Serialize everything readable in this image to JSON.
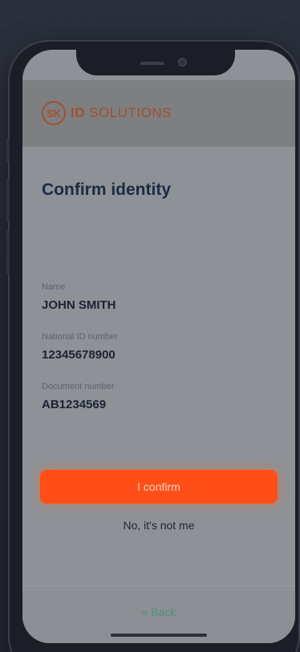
{
  "brand": {
    "logo_mark": "SK",
    "name_bold": "ID",
    "name_rest": " SOLUTIONS",
    "color": "#a2502f"
  },
  "screen": {
    "title": "Confirm identity"
  },
  "fields": [
    {
      "label": "Name",
      "value": "JOHN SMITH"
    },
    {
      "label": "National ID number",
      "value": "12345678900"
    },
    {
      "label": "Document number",
      "value": "AB1234569"
    }
  ],
  "actions": {
    "confirm_label": "I confirm",
    "reject_label": "No, it's not me",
    "confirm_color": "#ff4f17"
  },
  "footer": {
    "back_label": "« Back",
    "back_color": "#4e8f7d"
  }
}
